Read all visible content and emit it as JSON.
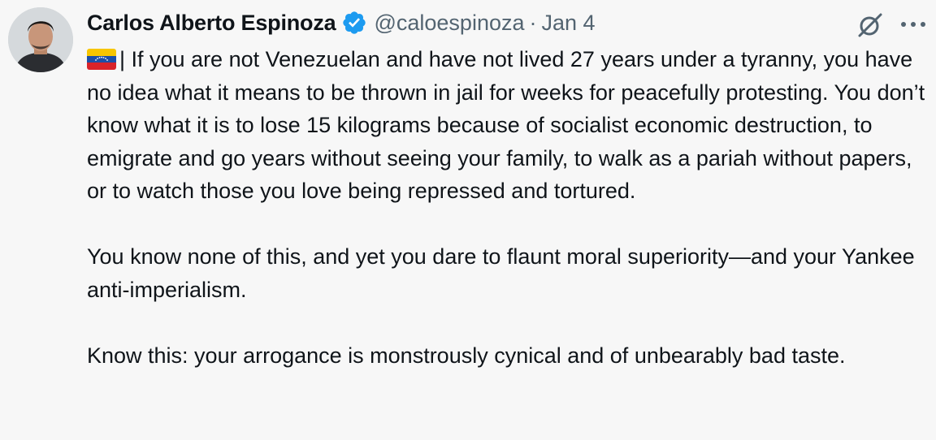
{
  "author": {
    "display_name": "Carlos Alberto Espinoza",
    "handle": "@caloespinoza",
    "separator": "·",
    "date": "Jan 4"
  },
  "icons": {
    "avatar": "avatar",
    "verified": "verified-badge-icon",
    "grok": "grok-icon",
    "more": "more-options-icon",
    "flag": "venezuela-flag-emoji"
  },
  "colors": {
    "verified_blue": "#1d9bf0",
    "secondary_text": "#536471",
    "primary_text": "#0f1419",
    "background": "#f7f7f7"
  },
  "tweet": {
    "paragraphs": [
      "| If you are not Venezuelan and have not lived 27 years under a tyranny, you have no idea what it means to be thrown in jail for weeks for peacefully protesting. You don’t know what it is to lose 15 kilograms because of socialist economic destruction, to emigrate and go years without seeing your family, to walk as a pariah without papers, or to watch those you love being repressed and tortured.",
      "You know none of this, and yet you dare to flaunt moral superiority—and your Yankee anti-imperialism.",
      "Know this: your arrogance is monstrously cynical and of unbearably bad taste."
    ]
  }
}
